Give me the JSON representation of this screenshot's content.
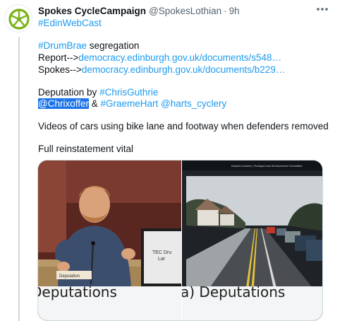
{
  "author": {
    "display_name": "Spokes CycleCampaign",
    "handle": "@SpokesLothian",
    "separator": "·",
    "time": "9h"
  },
  "tweet": {
    "line1_tag": "#EdinWebCast",
    "line2_tag": "#DrumBrae",
    "line2_rest": " segregation",
    "line3_label": "Report-->",
    "line3_link": "democracy.edinburgh.gov.uk/documents/s548…",
    "line4_label": "Spokes-->",
    "line4_link": "democracy.edinburgh.gov.uk/documents/b229…",
    "line5_label": "Deputation by ",
    "line5_mention": "#ChrisGuthrie",
    "line6_mention1": "@Chrixoffer",
    "line6_amp": " & ",
    "line6_mention2": "#GraemeHart",
    "line6_space": " ",
    "line6_mention3": "@harts_cyclery",
    "line7": "Videos of cars using bike lane and footway when defenders removed",
    "line8": "Full reinstatement vital"
  },
  "media": {
    "left_caption": "Deputations",
    "right_caption": "a) Deputations",
    "left_nameplate": "Deputation",
    "left_screen_text_1": "TEC Dru",
    "left_screen_text_2": "Lar",
    "right_header_text": "Dossed Lockers | Transport and Environment Committee"
  },
  "icons": {
    "more": "more-options-icon",
    "avatar": "spokes-wheel-logo-icon"
  },
  "colors": {
    "link": "#1d9bf0",
    "text": "#0f1419",
    "muted": "#536471",
    "logo_green": "#7ab317"
  }
}
